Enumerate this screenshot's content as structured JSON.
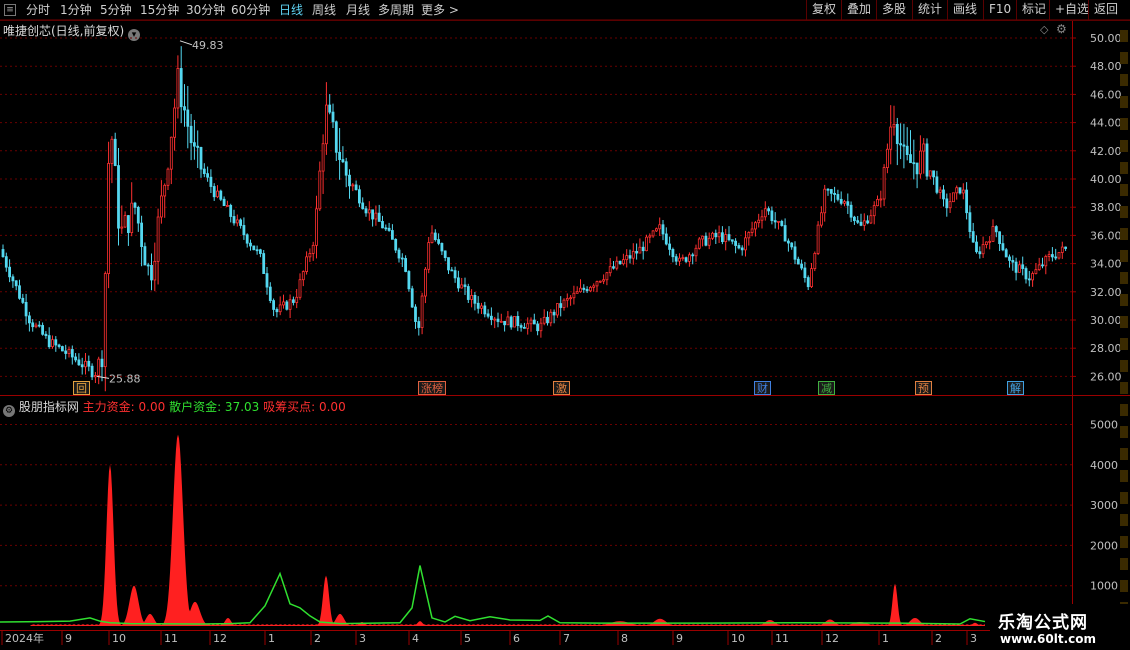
{
  "toolbar": {
    "menu_icon": "≡",
    "periods": [
      {
        "label": "分时",
        "active": false
      },
      {
        "label": "1分钟",
        "active": false
      },
      {
        "label": "5分钟",
        "active": false
      },
      {
        "label": "15分钟",
        "active": false
      },
      {
        "label": "30分钟",
        "active": false
      },
      {
        "label": "60分钟",
        "active": false
      },
      {
        "label": "日线",
        "active": true
      },
      {
        "label": "周线",
        "active": false
      },
      {
        "label": "月线",
        "active": false
      },
      {
        "label": "多周期",
        "active": false
      },
      {
        "label": "更多 >",
        "active": false
      }
    ],
    "right_buttons": [
      "复权",
      "叠加",
      "多股",
      "统计",
      "画线",
      "F10",
      "标记",
      "+自选",
      "返回"
    ]
  },
  "main_panel": {
    "title": "唯捷创芯(日线,前复权)",
    "price_axis": [
      "50.00",
      "48.00",
      "46.00",
      "44.00",
      "42.00",
      "40.00",
      "38.00",
      "36.00",
      "34.00",
      "32.00",
      "30.00",
      "28.00",
      "26.00"
    ],
    "high_marker": "49.83",
    "low_marker": "25.88",
    "event_tags": [
      {
        "label": "回",
        "color": "#e0a040"
      },
      {
        "label": "涨榜",
        "color": "#e06040"
      },
      {
        "label": "激",
        "color": "#e08040"
      },
      {
        "label": "财",
        "color": "#4080e0"
      },
      {
        "label": "减",
        "color": "#40b040"
      },
      {
        "label": "预",
        "color": "#e08040"
      },
      {
        "label": "解",
        "color": "#40a0e0"
      }
    ]
  },
  "indicator_panel": {
    "name": "股朋指标网",
    "main_label": "主力资金: 0.00",
    "retail_label": "散户资金: 37.03",
    "absorb_label": "吸筹买点: 0.00",
    "main_color": "#ff2020",
    "retail_color": "#30e030",
    "axis": [
      "5000",
      "4000",
      "3000",
      "2000",
      "1000"
    ]
  },
  "date_axis": [
    "2024年",
    "9",
    "10",
    "11",
    "12",
    "1",
    "2",
    "3",
    "4",
    "5",
    "6",
    "7",
    "8",
    "9",
    "10",
    "11",
    "12",
    "1",
    "2",
    "3"
  ],
  "watermark": {
    "title": "乐淘公式网",
    "url": "www.60lt.com"
  },
  "colors": {
    "up": "#ff3030",
    "down": "#54d8f0",
    "grid": "#6a0000"
  }
}
